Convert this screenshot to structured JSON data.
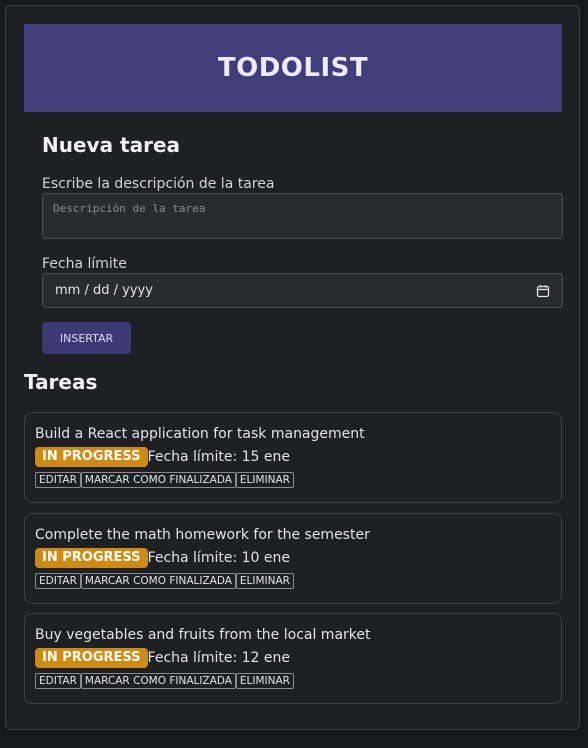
{
  "header": {
    "title": "TODOLIST"
  },
  "form": {
    "heading": "Nueva tarea",
    "description_label": "Escribe la descripción de la tarea",
    "description_placeholder": "Descripción de la tarea",
    "description_value": "",
    "date_label": "Fecha límite",
    "date_placeholder": "mm / dd / yyyy",
    "insert_label": "INSERTAR"
  },
  "tasks_section": {
    "heading": "Tareas"
  },
  "tasks": [
    {
      "description": "Build a React application for task management",
      "status": "IN PROGRESS",
      "due": "Fecha límite: 15 ene"
    },
    {
      "description": "Complete the math homework for the semester",
      "status": "IN PROGRESS",
      "due": "Fecha límite: 10 ene"
    },
    {
      "description": "Buy vegetables and fruits from the local market",
      "status": "IN PROGRESS",
      "due": "Fecha límite: 12 ene"
    }
  ],
  "task_actions": {
    "edit": "EDITAR",
    "finish": "MARCAR COMO FINALIZADA",
    "delete": "ELIMINAR"
  },
  "colors": {
    "header_bg": "#403e7a",
    "button_bg": "#3c3a74",
    "badge_in_progress": "#cf8a11",
    "background": "#1e2023"
  }
}
